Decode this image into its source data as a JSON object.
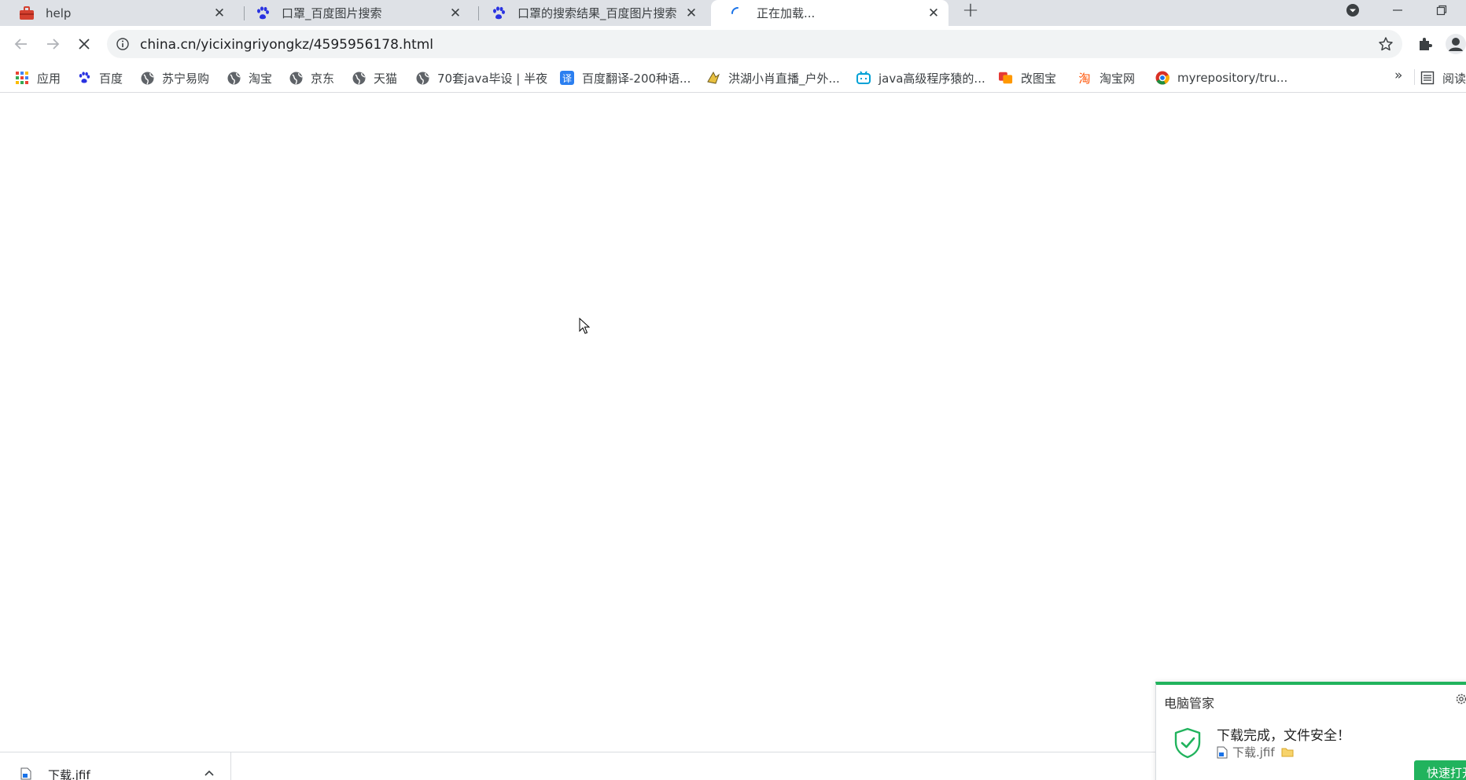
{
  "tabs": [
    {
      "title": "help",
      "icon": "toolbox-icon"
    },
    {
      "title": "口罩_百度图片搜索",
      "icon": "baidu-paw-icon"
    },
    {
      "title": "口罩的搜索结果_百度图片搜索",
      "icon": "baidu-paw-icon"
    },
    {
      "title": "正在加载...",
      "icon": "loading-spinner-icon",
      "active": true
    }
  ],
  "address_bar": {
    "url": "china.cn/yicixingriyongkz/4595956178.html"
  },
  "bookmarks": [
    {
      "label": "应用",
      "icon": "apps-grid-icon"
    },
    {
      "label": "百度",
      "icon": "baidu-paw-icon"
    },
    {
      "label": "苏宁易购",
      "icon": "globe-icon"
    },
    {
      "label": "淘宝",
      "icon": "globe-icon"
    },
    {
      "label": "京东",
      "icon": "globe-icon"
    },
    {
      "label": "天猫",
      "icon": "globe-icon"
    },
    {
      "label": "70套java毕设 | 半夜",
      "icon": "globe-icon"
    },
    {
      "label": "百度翻译-200种语...",
      "icon": "baidu-translate-icon"
    },
    {
      "label": "洪湖小肖直播_户外...",
      "icon": "bird-icon"
    },
    {
      "label": "java高级程序猿的...",
      "icon": "bilibili-tv-icon"
    },
    {
      "label": "改图宝",
      "icon": "orange-squares-icon"
    },
    {
      "label": "淘宝网",
      "icon": "taobao-tao-icon"
    },
    {
      "label": "myrepository/tru...",
      "icon": "chrome-like-icon"
    }
  ],
  "bookmarks_overflow": "»",
  "reading_list": "阅读",
  "popup": {
    "title": "电脑管家",
    "message": "下载完成，文件安全！",
    "file_name": "下载.jfif",
    "action": "快速打开",
    "accent_color": "#21b35d"
  },
  "download_shelf": {
    "items": [
      {
        "name": "下载.jfif"
      }
    ]
  }
}
